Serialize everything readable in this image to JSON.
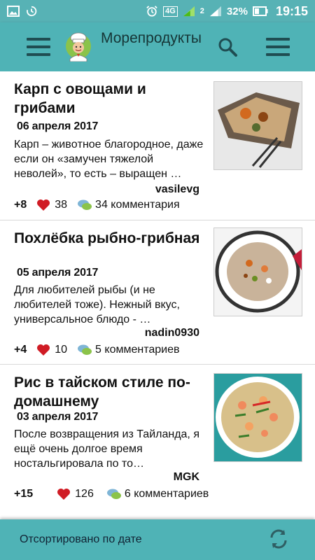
{
  "status_bar": {
    "network_label": "4G",
    "sim2_label": "2",
    "battery_percent": "32%",
    "time": "19:15"
  },
  "app_bar": {
    "title": "Морепродукты"
  },
  "recipes": [
    {
      "title": "Карп с овощами и грибами",
      "date": "06 апреля 2017",
      "excerpt": "Карп – живoтное благородное, даже если он «замучен тяжелой неволей», то есть – выращен …",
      "author": "vasilevg",
      "score": "+8",
      "likes": "38",
      "comments": "34 комментария"
    },
    {
      "title": "Похлёбка рыбно-грибная",
      "date": "05 апреля 2017",
      "excerpt": "Для любителей рыбы (и не любителей тоже). Нежный вкус, универсальное блюдо - …",
      "author": "nadin0930",
      "score": "+4",
      "likes": "10",
      "comments": "5 комментариев"
    },
    {
      "title": "Рис в тайском стиле по-домашнему",
      "date": "03 апреля 2017",
      "excerpt": "После возвращения из Тайланда, я ещё очень долгое время ностальгировала по то…",
      "author": "MGK",
      "score": "+15",
      "likes": "126",
      "comments": "6 комментариев"
    }
  ],
  "bottom_bar": {
    "sort_label": "Отсортировано по дате"
  },
  "colors": {
    "primary": "#4fb3b6",
    "status_bar": "#57b2b5",
    "heart": "#d01c25",
    "text": "#111111"
  },
  "icons": [
    "gallery-icon",
    "sync-icon",
    "alarm-icon",
    "signal-icon",
    "battery-icon",
    "menu-icon",
    "chef-logo",
    "search-icon",
    "heart-icon",
    "comment-icon",
    "refresh-icon"
  ]
}
